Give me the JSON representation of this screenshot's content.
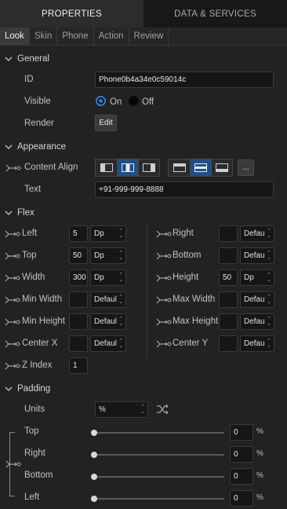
{
  "top_tabs": [
    "PROPERTIES",
    "DATA & SERVICES"
  ],
  "sub_tabs": [
    "Look",
    "Skin",
    "Phone",
    "Action",
    "Review"
  ],
  "general": {
    "title": "General",
    "id_label": "ID",
    "id_value": "Phone0b4a34e0c59014c",
    "visible_label": "Visible",
    "on_label": "On",
    "off_label": "Off",
    "render_label": "Render",
    "edit_label": "Edit"
  },
  "appearance": {
    "title": "Appearance",
    "content_align_label": "Content Align",
    "more_label": "...",
    "text_label": "Text",
    "text_value": "+91-999-999-8888"
  },
  "flex": {
    "title": "Flex",
    "left": {
      "label": "Left",
      "value": "5",
      "unit": "Dp"
    },
    "top": {
      "label": "Top",
      "value": "50",
      "unit": "Dp"
    },
    "width": {
      "label": "Width",
      "value": "300",
      "unit": "Dp"
    },
    "min_width": {
      "label": "Min Width",
      "value": "",
      "unit": "Default"
    },
    "min_height": {
      "label": "Min Height",
      "value": "",
      "unit": "Default"
    },
    "center_x": {
      "label": "Center X",
      "value": "",
      "unit": "Default"
    },
    "z_index": {
      "label": "Z Index",
      "value": "1"
    },
    "right": {
      "label": "Right",
      "value": "",
      "unit": "Default"
    },
    "bottom": {
      "label": "Bottom",
      "value": "",
      "unit": "Default"
    },
    "height": {
      "label": "Height",
      "value": "50",
      "unit": "Dp"
    },
    "max_width": {
      "label": "Max Width",
      "value": "",
      "unit": "Default"
    },
    "max_height": {
      "label": "Max Height",
      "value": "",
      "unit": "Default"
    },
    "center_y": {
      "label": "Center Y",
      "value": "",
      "unit": "Default"
    }
  },
  "padding": {
    "title": "Padding",
    "units_label": "Units",
    "units_value": "%",
    "percent_symbol": "%",
    "rows": [
      {
        "label": "Top",
        "value": "0"
      },
      {
        "label": "Right",
        "value": "0"
      },
      {
        "label": "Bottom",
        "value": "0"
      },
      {
        "label": "Left",
        "value": "0"
      }
    ]
  },
  "colors": {
    "accent": "#2f7fd0",
    "selected_align": "#1f4f86",
    "background": "#222222"
  }
}
